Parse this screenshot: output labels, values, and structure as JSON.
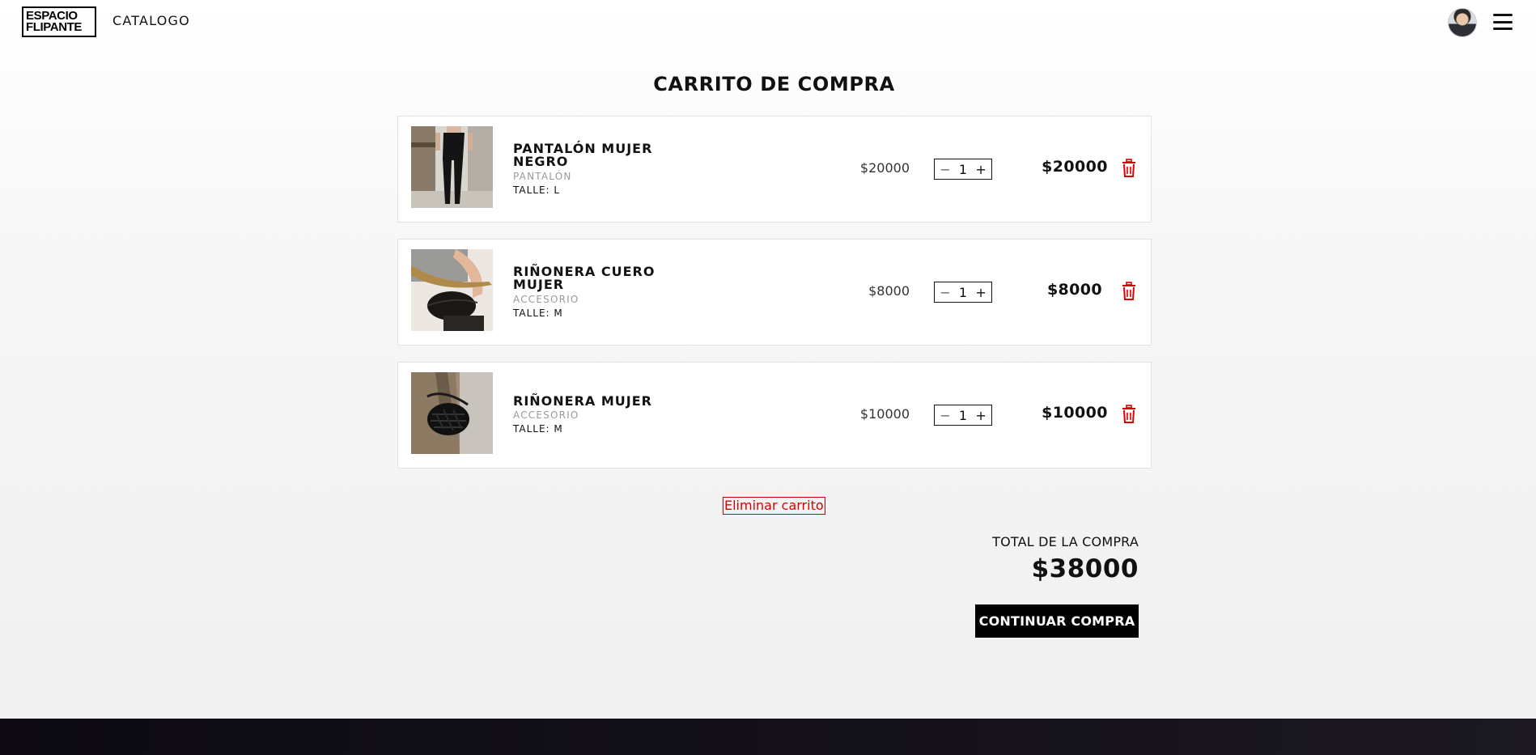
{
  "header": {
    "logo_line1": "ESPACIO",
    "logo_line2": "FLIPANTE",
    "nav_catalog": "CATALOGO"
  },
  "page": {
    "title": "CARRITO DE COMPRA"
  },
  "cart": {
    "items": [
      {
        "name": "PANTALÓN MUJER NEGRO",
        "category": "PANTALÓN",
        "size": "TALLE: L",
        "unit_price": "$20000",
        "quantity": "1",
        "line_total": "$20000"
      },
      {
        "name": "RIÑONERA CUERO MUJER",
        "category": "ACCESORIO",
        "size": "TALLE: M",
        "unit_price": "$8000",
        "quantity": "1",
        "line_total": "$8000"
      },
      {
        "name": "RIÑONERA MUJER",
        "category": "ACCESORIO",
        "size": "TALLE: M",
        "unit_price": "$10000",
        "quantity": "1",
        "line_total": "$10000"
      }
    ],
    "minus_symbol": "−",
    "plus_symbol": "+",
    "clear_cart_label": "Eliminar carrito",
    "total_label": "TOTAL DE LA COMPRA",
    "total_value": "$38000",
    "checkout_label": "CONTINUAR COMPRA"
  },
  "colors": {
    "accent_red": "#dd0000",
    "primary_black": "#000000"
  },
  "icons": {
    "user": "avatar",
    "menu": "hamburger-menu-icon",
    "delete": "trash-icon"
  }
}
